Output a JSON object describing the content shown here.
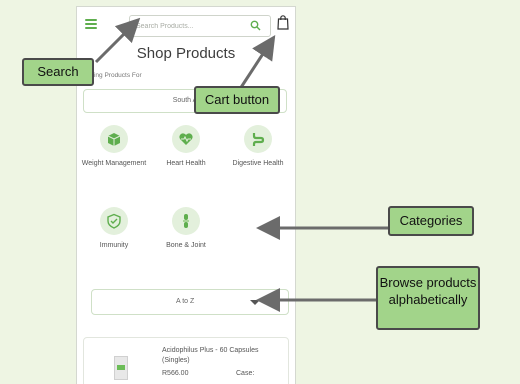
{
  "header": {
    "search_placeholder": "Search Products..."
  },
  "page": {
    "title": "Shop Products",
    "viewing_label": "Viewing Products For",
    "region_value": "South A"
  },
  "categories": [
    {
      "label": "Weight Management",
      "icon": "box-icon"
    },
    {
      "label": "Heart Health",
      "icon": "heart-icon"
    },
    {
      "label": "Digestive Health",
      "icon": "digestive-icon"
    },
    {
      "label": "Immunity",
      "icon": "shield-icon"
    },
    {
      "label": "Bone & Joint",
      "icon": "bone-icon"
    }
  ],
  "sort": {
    "value": "A to Z"
  },
  "product": {
    "name": "Acidophilus Plus - 60 Capsules (Singles)",
    "price": "R566.00",
    "case_label": "Case:"
  },
  "annotations": {
    "search": "Search",
    "cart": "Cart button",
    "categories": "Categories",
    "browse": "Browse products alphabetically"
  },
  "colors": {
    "accent": "#5fae4e",
    "callout": "#a2d48a",
    "background": "#eef5e3"
  }
}
